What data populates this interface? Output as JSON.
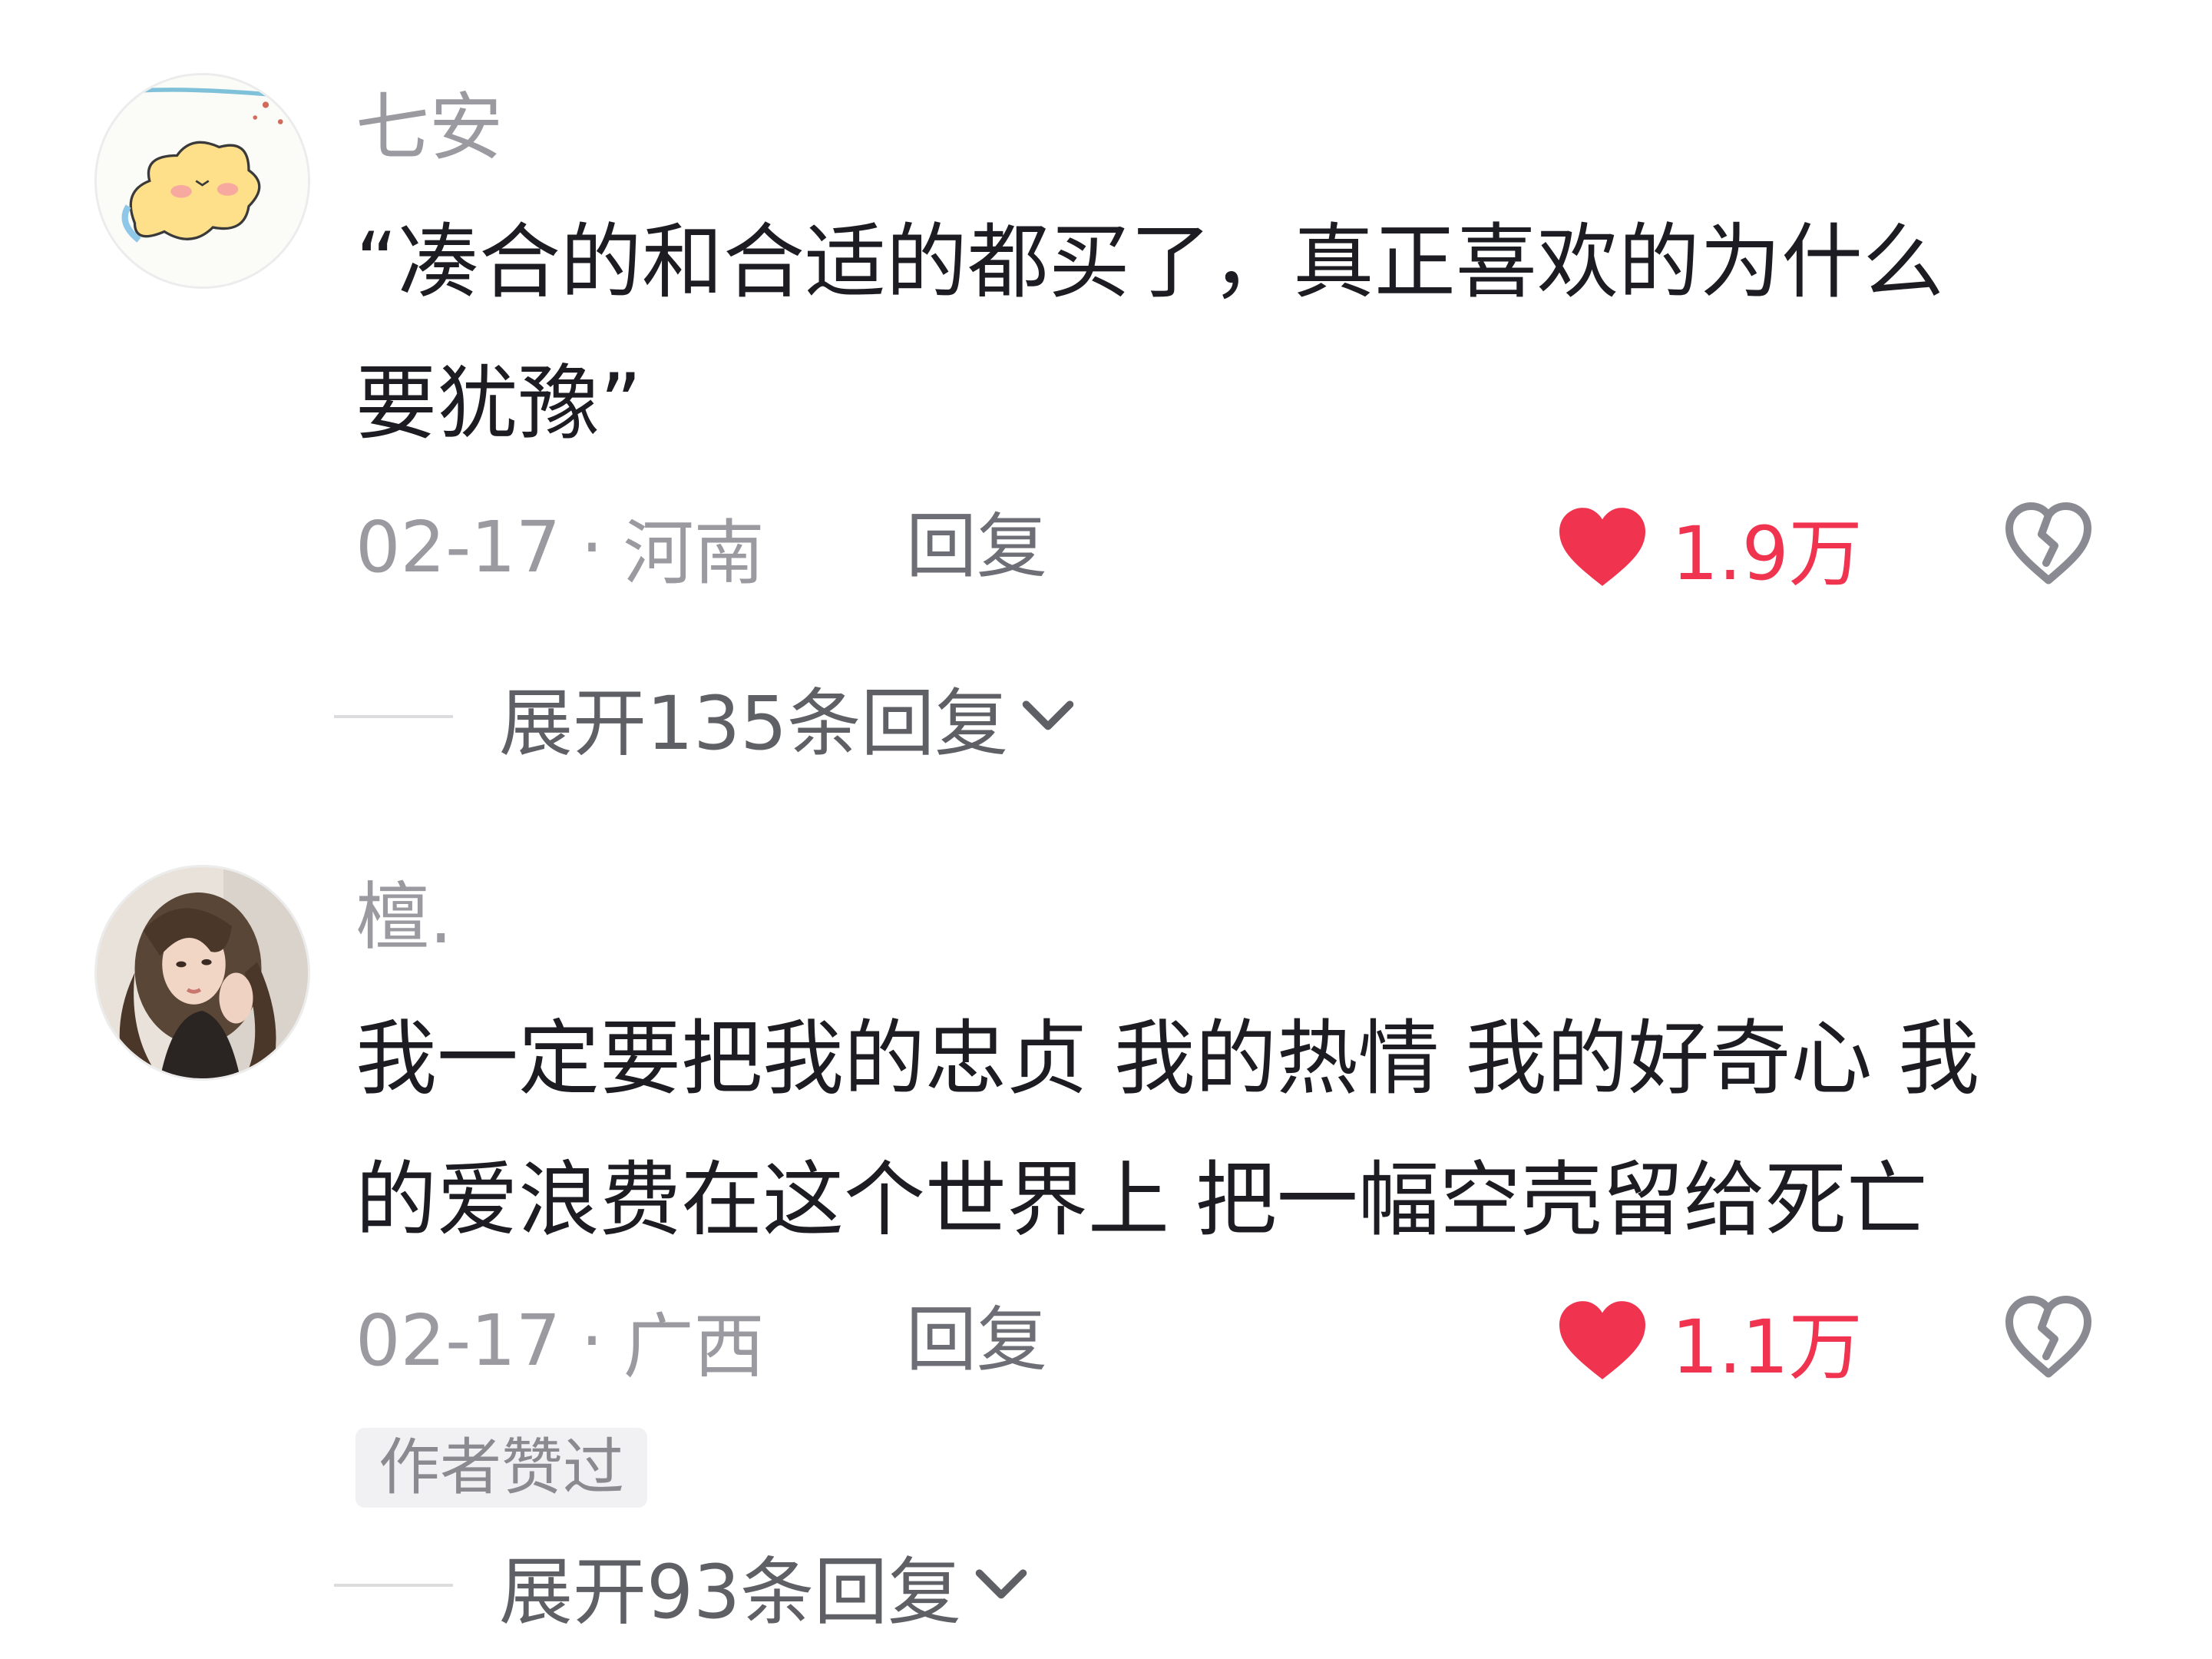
{
  "colors": {
    "accent_like": "#f0334f",
    "username": "#9a9aa0",
    "text": "#1c1c22",
    "badge_bg": "#f1f1f3"
  },
  "comments": [
    {
      "avatar_icon": "cartoon-dog-avatar",
      "username": "七安",
      "text_lines": [
        "“凑合的和合适的都买了，真正喜欢的为什么",
        "要犹豫”"
      ],
      "date": "02-17",
      "separator": "·",
      "location": "河南",
      "reply_label": "回复",
      "like_count": "1.9万",
      "like_icon": "heart-filled-icon",
      "dislike_icon": "broken-heart-icon",
      "expand_label": "展开135条回复",
      "expand_icon": "chevron-down-icon"
    },
    {
      "avatar_icon": "portrait-photo-avatar",
      "username": "檀.",
      "text_lines": [
        "我一定要把我的忠贞 我的热情 我的好奇心 我",
        "的爱浪费在这个世界上 把一幅空壳留给死亡"
      ],
      "date": "02-17",
      "separator": "·",
      "location": "广西",
      "reply_label": "回复",
      "like_count": "1.1万",
      "like_icon": "heart-filled-icon",
      "dislike_icon": "broken-heart-icon",
      "badge": "作者赞过",
      "expand_label": "展开93条回复",
      "expand_icon": "chevron-down-icon"
    }
  ]
}
